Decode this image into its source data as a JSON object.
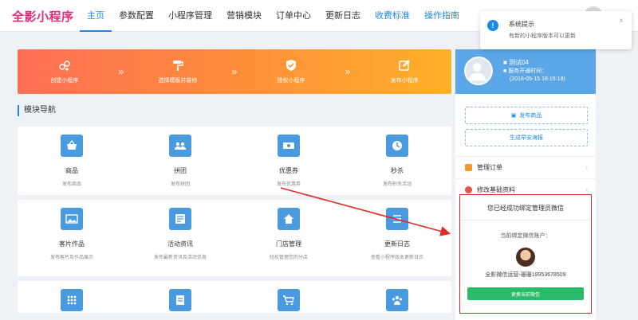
{
  "brand": {
    "logo_text": "全影小程序",
    "accent": "#1a8ae8",
    "logo_color": "#e3287a"
  },
  "nav": {
    "items": [
      {
        "label": "主页",
        "active": true
      },
      {
        "label": "参数配置"
      },
      {
        "label": "小程序管理"
      },
      {
        "label": "营销模块"
      },
      {
        "label": "订单中心"
      },
      {
        "label": "更新日志"
      },
      {
        "label": "收费标准",
        "link": true
      },
      {
        "label": "操作指南",
        "link": true
      }
    ]
  },
  "banner": {
    "steps": [
      {
        "label": "创建小程序",
        "icon": "mini-program-icon"
      },
      {
        "label": "选择模板并装修",
        "icon": "paint-roller-icon"
      },
      {
        "label": "授权小程序",
        "icon": "shield-check-icon"
      },
      {
        "label": "发布小程序",
        "icon": "edit-icon"
      }
    ],
    "arrow": "»"
  },
  "section": {
    "title": "模块导航"
  },
  "modules": {
    "row1": [
      {
        "title": "商品",
        "desc": "发布商品",
        "icon": "basket-icon"
      },
      {
        "title": "拼团",
        "desc": "发布拼团",
        "icon": "group-icon"
      },
      {
        "title": "优惠券",
        "desc": "发布优惠券",
        "icon": "coupon-icon"
      },
      {
        "title": "秒杀",
        "desc": "发布秒杀活动",
        "icon": "timer-icon"
      }
    ],
    "row2": [
      {
        "title": "客片作品",
        "desc": "发布客片及作品展示",
        "icon": "image-icon"
      },
      {
        "title": "活动资讯",
        "desc": "发布最新资讯及活动信息",
        "icon": "news-icon"
      },
      {
        "title": "门店管理",
        "desc": "轻松管理您的分店",
        "icon": "store-icon"
      },
      {
        "title": "更新日志",
        "desc": "查看小程序版本更新日志",
        "icon": "log-icon"
      }
    ],
    "row3": [
      {
        "icon": "apps-icon"
      },
      {
        "icon": "document-icon"
      },
      {
        "icon": "cart-icon"
      },
      {
        "icon": "team-icon"
      }
    ]
  },
  "profile": {
    "name": "测试04",
    "since_label": "服务开通时间：",
    "since_date": "(2018-05-15 16:15:18)"
  },
  "side": {
    "publish_btn": "发布商品",
    "poster_btn": "生成早安海报",
    "menu": [
      {
        "label": "管理订单",
        "icon": "order-icon",
        "color": "#f39a2d"
      },
      {
        "label": "修改基础资料",
        "icon": "check-circle-icon",
        "color": "#e8504a"
      }
    ],
    "chevron": "›"
  },
  "wechat": {
    "title": "您已经成功绑定管理员微信",
    "bound_label": "当前绑定微信账户：",
    "account": "全影微信运营-珊珊19953678509",
    "change_btn": "更换当前微信",
    "button_color": "#2bba6a",
    "border_color": "#e02a2a"
  },
  "toast": {
    "title": "系统提示",
    "message": "有新的小程序版本可以更新",
    "close": "×",
    "icon_glyph": "!"
  }
}
